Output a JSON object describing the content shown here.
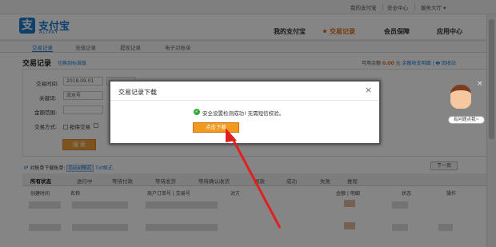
{
  "topbar": {
    "items": [
      "我的支付宝",
      "安全中心",
      "服务大厅 ▾"
    ]
  },
  "header": {
    "logo_glyph": "支",
    "logo_text": "支付宝",
    "logo_sub": "ALIPAY",
    "nav": [
      "我的支付宝",
      "交易记录",
      "会员保障",
      "应用中心"
    ],
    "active_nav": "交易记录"
  },
  "subtabs": [
    "交易记录",
    "充值记录",
    "提现记录",
    "电子对账单"
  ],
  "page": {
    "title": "交易记录",
    "switch_link": "切换到标准版",
    "balance_label": "可用余额",
    "balance_value": "0.00",
    "balance_unit": "元",
    "balance_links": "余额收支明细 | 🖶 回收站"
  },
  "filters": {
    "time_label": "交易时间:",
    "time_value": "2018.09.01",
    "keyword_label": "关键词:",
    "keyword_value": "流水号",
    "amount_label": "金额范围:",
    "method_label": "交易方式:",
    "method_option": "担保交易",
    "search_button": "搜 索"
  },
  "export": {
    "prefix": "IP",
    "text": "对账单下载账单:",
    "excel": "Excel格式",
    "txt": "Txt格式",
    "next": "下一页"
  },
  "status_tabs": [
    "所有状态",
    "进行中",
    "等待付款",
    "等待发货",
    "等待确认收货",
    "退款",
    "成功",
    "失败",
    "推程"
  ],
  "table_headers": [
    "创建时间",
    "名称",
    "商户订单号 | 交易号",
    "对方",
    "金额 | 明细",
    "状态",
    "操作"
  ],
  "dialog": {
    "title": "交易记录下载",
    "close": "×",
    "message": "安全设置检测成功! 无需短信校验。",
    "button": "点击下载"
  },
  "side_widget": {
    "close": "×",
    "label": "有问题点我~"
  },
  "colors": {
    "brand_blue": "#1b7bd4",
    "accent_orange": "#f29a1f",
    "arrow_red": "#e02020"
  }
}
